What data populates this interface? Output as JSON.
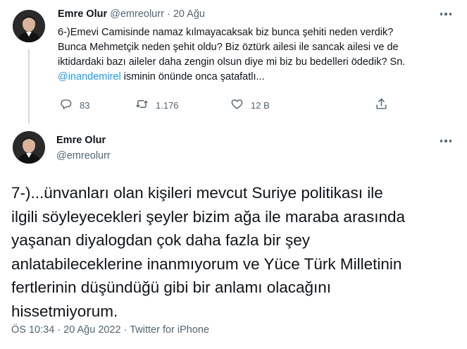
{
  "tweet1": {
    "display_name": "Emre Olur",
    "handle": "@emreolurr",
    "separator": "·",
    "date": "20 Ağu",
    "lines": [
      "6-)Emevi Camisinde namaz kılmayacaksak biz bunca şehiti neden verdik?",
      "Bunca Mehmetçik neden şehit oldu? Biz öztürk ailesi ile sancak ailesi ve de",
      "iktidardaki bazı aileler daha zengin olsun diye mi biz bu bedelleri ödedik? Sn."
    ],
    "mention": "@inandemirel",
    "last_line_rest": " isminin önünde onca şatafatlı...",
    "stats": {
      "replies": "83",
      "retweets": "1.176",
      "likes": "12 B"
    }
  },
  "tweet2": {
    "display_name": "Emre Olur",
    "handle": "@emreolurr",
    "lines": [
      "7-)...ünvanları olan kişileri mevcut Suriye politikası ile",
      "ilgili söyleyecekleri şeyler bizim ağa ile maraba arasında",
      "yaşanan diyalogdan çok daha fazla bir şey",
      "anlatabileceklerine inanmıyorum ve Yüce Türk Milletinin",
      "fertlerinin düşündüğü gibi bir anlamı olacağını",
      "hissetmiyorum."
    ],
    "timestamp": "ÖS 10:34 · 20 Ağu 2022 · Twitter for iPhone"
  },
  "icons": {
    "reply": "reply-icon",
    "retweet": "retweet-icon",
    "like": "heart-icon",
    "share": "share-icon",
    "more": "more-icon"
  },
  "colors": {
    "text": "#0f1419",
    "muted": "#536471",
    "link": "#1d9bf0",
    "thread_line": "#cfd9de"
  }
}
